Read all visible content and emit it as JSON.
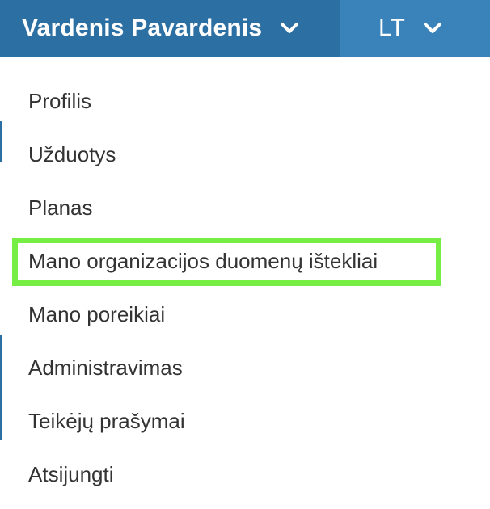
{
  "header": {
    "user_name": "Vardenis Pavardenis",
    "user_chevron_icon": "chevron-down-icon",
    "language": "LT",
    "language_chevron_icon": "chevron-down-icon",
    "colors": {
      "user_bar": "#2c6fa3",
      "lang_bar": "#3a83ba",
      "text": "#ffffff"
    }
  },
  "menu": {
    "items": [
      {
        "label": "Profilis"
      },
      {
        "label": "Užduotys"
      },
      {
        "label": "Planas"
      },
      {
        "label": "Mano organizacijos duomenų ištekliai",
        "highlighted": true
      },
      {
        "label": "Mano poreikiai"
      },
      {
        "label": "Administravimas"
      },
      {
        "label": "Teikėjų prašymai"
      },
      {
        "label": "Atsijungti"
      }
    ],
    "highlight_color": "#76ee44",
    "text_color": "#333333"
  }
}
